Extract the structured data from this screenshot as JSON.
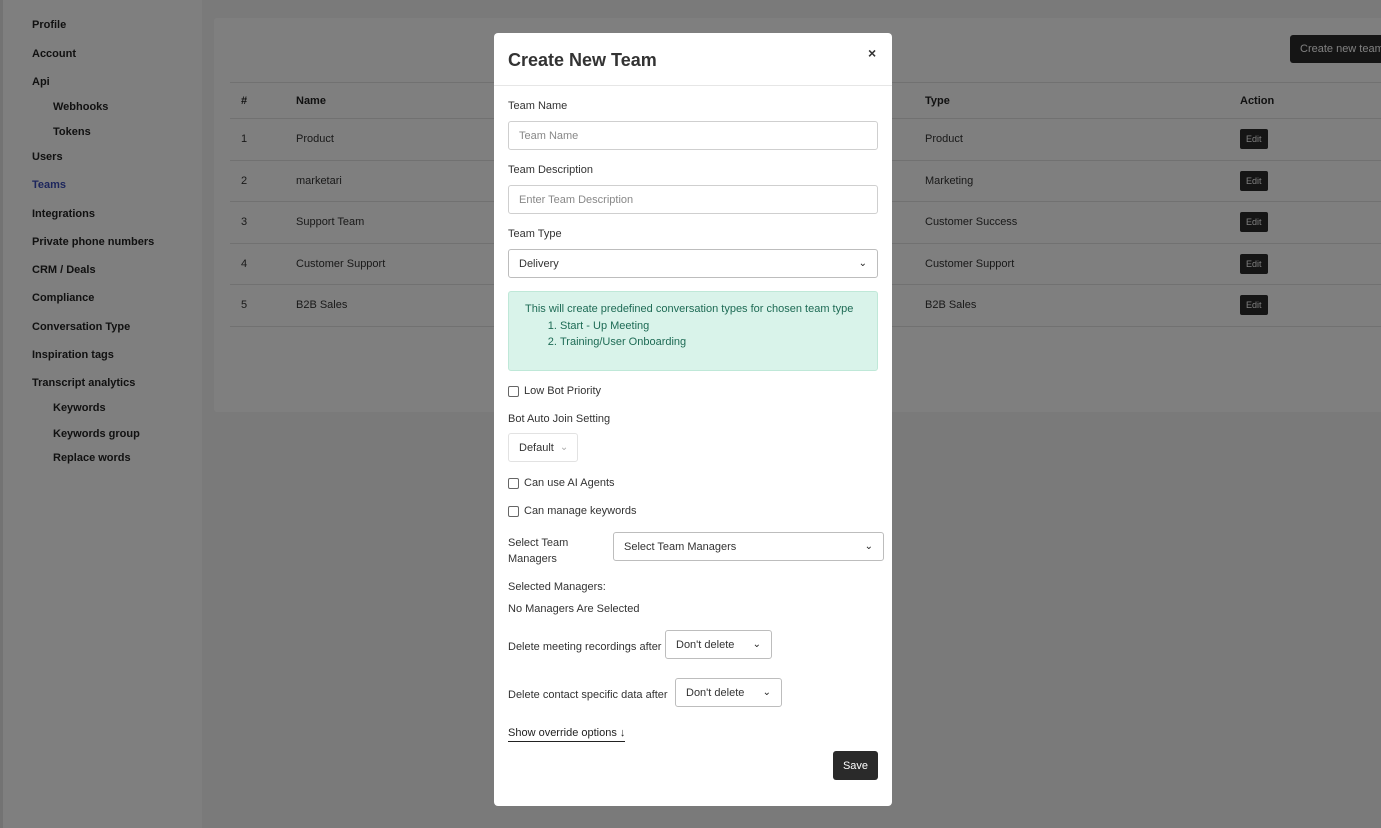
{
  "sidebar": {
    "items": [
      {
        "label": "Profile"
      },
      {
        "label": "Account"
      },
      {
        "label": "Api"
      },
      {
        "label": "Webhooks"
      },
      {
        "label": "Tokens"
      },
      {
        "label": "Users"
      },
      {
        "label": "Teams"
      },
      {
        "label": "Integrations"
      },
      {
        "label": "Private phone numbers"
      },
      {
        "label": "CRM / Deals"
      },
      {
        "label": "Compliance"
      },
      {
        "label": "Conversation Type"
      },
      {
        "label": "Inspiration tags"
      },
      {
        "label": "Transcript analytics"
      },
      {
        "label": "Keywords"
      },
      {
        "label": "Keywords group"
      },
      {
        "label": "Replace words"
      }
    ],
    "active": "Teams",
    "active_color": "#3b4cb8"
  },
  "main": {
    "create_button": "Create new team",
    "table": {
      "headers": {
        "num": "#",
        "name": "Name",
        "type": "Type",
        "action": "Action"
      },
      "rows": [
        {
          "num": "1",
          "name": "Product",
          "type": "Product",
          "action": "Edit"
        },
        {
          "num": "2",
          "name": "marketari",
          "type": "Marketing",
          "action": "Edit"
        },
        {
          "num": "3",
          "name": "Support Team",
          "type": "Customer Success",
          "action": "Edit"
        },
        {
          "num": "4",
          "name": "Customer Support",
          "type": "Customer Support",
          "action": "Edit"
        },
        {
          "num": "5",
          "name": "B2B Sales",
          "type": "B2B Sales",
          "action": "Edit"
        }
      ]
    }
  },
  "modal": {
    "title": "Create New Team",
    "close_icon": "×",
    "team_name": {
      "label": "Team Name",
      "placeholder": "Team Name",
      "value": ""
    },
    "team_description": {
      "label": "Team Description",
      "placeholder": "Enter Team Description",
      "value": ""
    },
    "team_type": {
      "label": "Team Type",
      "selected": "Delivery"
    },
    "info": {
      "text": "This will create predefined conversation types for chosen team type",
      "items": [
        "Start - Up Meeting",
        "Training/User Onboarding"
      ]
    },
    "low_bot_priority": {
      "label": "Low Bot Priority",
      "checked": false
    },
    "bot_auto_join": {
      "label": "Bot Auto Join Setting",
      "selected": "Default"
    },
    "can_use_ai_agents": {
      "label": "Can use AI Agents",
      "checked": false
    },
    "can_manage_keywords": {
      "label": "Can manage keywords",
      "checked": false
    },
    "team_managers": {
      "label_line1": "Select Team",
      "label_line2": "Managers",
      "selected": "Select Team Managers"
    },
    "selected_managers": {
      "label": "Selected Managers:",
      "value": "No Managers Are Selected"
    },
    "delete_recordings": {
      "label": "Delete meeting recordings after",
      "selected": "Don't delete"
    },
    "delete_contact_data": {
      "label": "Delete contact specific data after",
      "selected": "Don't delete"
    },
    "override_link": "Show override options ↓",
    "save_button": "Save"
  },
  "colors": {
    "overlay": "rgba(0,0,0,0.5)",
    "button_dark": "#2a2a2a",
    "info_bg": "#d9f3ea",
    "info_text": "#1e6b55"
  }
}
